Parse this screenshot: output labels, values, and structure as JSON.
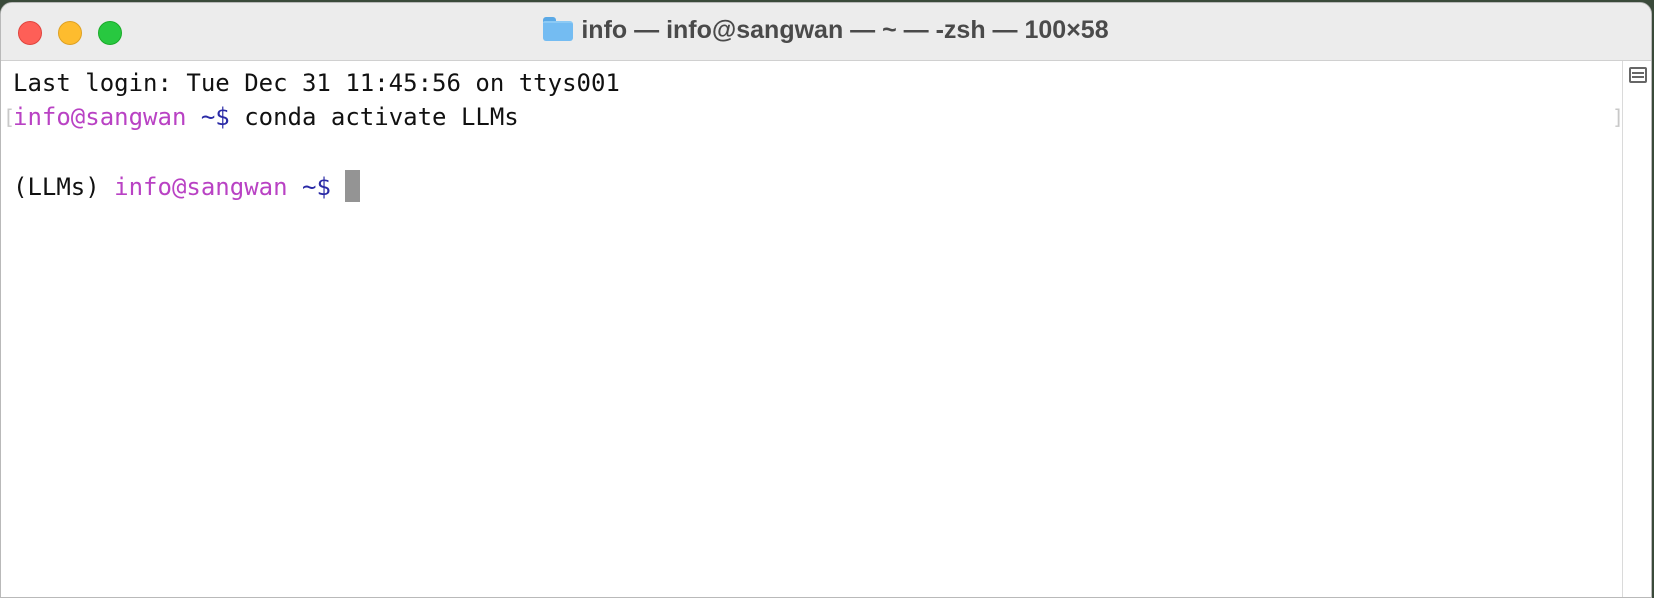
{
  "window": {
    "title": "info — info@sangwan — ~ — -zsh — 100×58",
    "title_icon": "folder-icon"
  },
  "terminal": {
    "lines": [
      {
        "text": "Last login: Tue Dec 31 11:45:56 on ttys001"
      },
      {
        "user": "info@sangwan",
        "path": "~$",
        "command": " conda activate LLMs"
      },
      {
        "env": "(LLMs) ",
        "user": "info@sangwan",
        "path": "~$",
        "command": " "
      }
    ],
    "left_bracket": "[",
    "right_bracket": "]"
  },
  "colors": {
    "user": "#b942c4",
    "path": "#2a2aa6",
    "close": "#fe5f57",
    "minimize": "#febc2e",
    "zoom": "#28c840"
  }
}
